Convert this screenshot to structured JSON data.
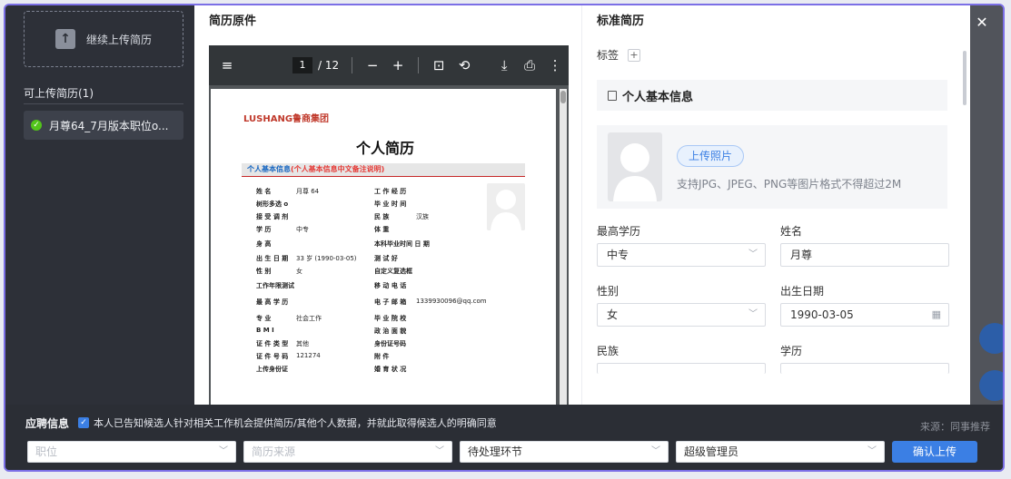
{
  "sidebar": {
    "upload_more_label": "继续上传简历",
    "list_title": "可上传简历(1)",
    "items": [
      {
        "label": "月尊64_7月版本职位o..."
      }
    ]
  },
  "preview": {
    "title": "简历原件",
    "pdf": {
      "current_page": "1",
      "total_pages": "/ 12"
    },
    "doc": {
      "logo": "LUSHANG鲁商集团",
      "title": "个人简历",
      "section_bar": "个人基本信息",
      "section_bar_note": "(个人基本信息中文备注说明)",
      "rows": [
        {
          "l": "姓 名",
          "v": "月尊 64",
          "l2": "工 作 经 历",
          "v2": ""
        },
        {
          "l": "树形多选 o",
          "v": "",
          "l2": "毕 业 时 间",
          "v2": ""
        },
        {
          "l": "接 受 调 剂",
          "v": "",
          "l2": "民 族",
          "v2": "汉族"
        },
        {
          "l": "学 历",
          "v": "中专",
          "l2": "体 重",
          "v2": ""
        },
        {
          "l": "身 高",
          "v": "",
          "l2": "本科毕业时间 日 期",
          "v2": ""
        },
        {
          "l": "出 生 日 期",
          "v": "33 岁 (1990-03-05)",
          "l2": "测 试 好",
          "v2": ""
        },
        {
          "l": "性 别",
          "v": "女",
          "l2": "自定义复选框",
          "v2": ""
        },
        {
          "l": "工作年限测试",
          "v": "",
          "l2": "移 动 电 话",
          "v2": ""
        },
        {
          "l": "最 高 学 历",
          "v": "",
          "l2": "电 子 邮 箱",
          "v2": "1339930096@qq.com"
        },
        {
          "l": "专 业",
          "v": "社会工作",
          "l2": "毕 业 院 校",
          "v2": ""
        },
        {
          "l": "B M I",
          "v": "",
          "l2": "政 治 面 貌",
          "v2": ""
        },
        {
          "l": "证 件 类 型",
          "v": "其他",
          "l2": "身份证号码",
          "v2": ""
        },
        {
          "l": "证 件 号 码",
          "v": "121274",
          "l2": "附 件",
          "v2": ""
        },
        {
          "l": "上传身份证",
          "v": "",
          "l2": "婚 育 状 况",
          "v2": ""
        }
      ]
    }
  },
  "form": {
    "title": "标准简历",
    "tag_label": "标签",
    "tag_add": "+",
    "section_title": "个人基本信息",
    "upload_photo": "上传照片",
    "photo_hint": "支持JPG、JPEG、PNG等图片格式不得超过2M",
    "fields": {
      "edu_label": "最高学历",
      "edu_value": "中专",
      "name_label": "姓名",
      "name_value": "月尊",
      "gender_label": "性别",
      "gender_value": "女",
      "dob_label": "出生日期",
      "dob_value": "1990-03-05",
      "ethnic_label": "民族",
      "degree_label": "学历"
    }
  },
  "bottom": {
    "label": "应聘信息",
    "consent": "本人已告知候选人针对相关工作机会提供简历/其他个人数据，并就此取得候选人的明确同意",
    "source": "来源：同事推荐",
    "position_placeholder": "职位",
    "source_placeholder": "简历来源",
    "stage": "待处理环节",
    "owner": "超级管理员",
    "confirm": "确认上传"
  },
  "icons": {
    "close": "close-icon",
    "menu": "menu-icon",
    "zoom_out": "minus-icon",
    "zoom_in": "plus-icon",
    "fit": "fit-page-icon",
    "rotate": "rotate-icon",
    "download": "download-icon",
    "print": "print-icon",
    "more": "more-vertical-icon"
  },
  "colors": {
    "accent": "#3b7fe4",
    "success": "#52c41a",
    "frame": "#7b6fe6"
  }
}
